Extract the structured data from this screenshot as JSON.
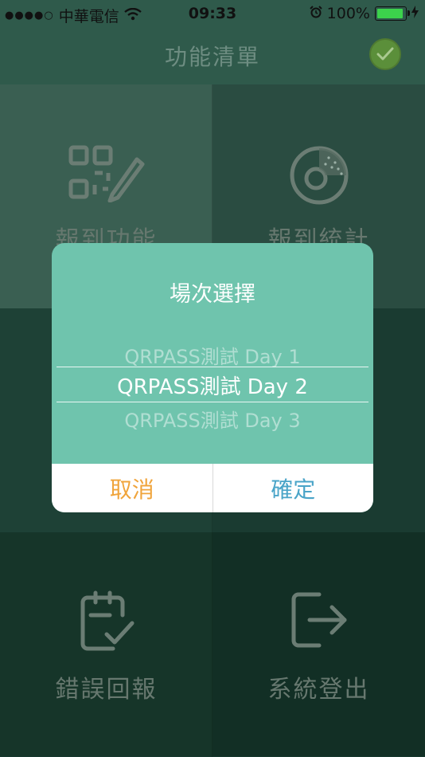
{
  "status_bar": {
    "signal": "●●●●○",
    "carrier": "中華電信",
    "time": "09:33",
    "battery_percent": "100%",
    "battery_level": 1.0
  },
  "nav": {
    "title": "功能清單",
    "check_icon": "checkmark-icon"
  },
  "menu": [
    {
      "label": "報到功能",
      "icon": "qr-code-pen-icon"
    },
    {
      "label": "報到統計",
      "icon": "pie-chart-icon"
    },
    {
      "label": "",
      "icon": ""
    },
    {
      "label": "",
      "icon": ""
    },
    {
      "label": "錯誤回報",
      "icon": "clipboard-check-icon"
    },
    {
      "label": "系統登出",
      "icon": "logout-icon"
    }
  ],
  "dialog": {
    "title": "場次選擇",
    "options": [
      "QRPASS測試 Day 1",
      "QRPASS測試 Day 2",
      "QRPASS測試 Day 3"
    ],
    "selected_index": 1,
    "cancel_label": "取消",
    "confirm_label": "確定"
  },
  "colors": {
    "dialog_bg": "#6fc4ad",
    "cancel": "#f0a43b",
    "confirm": "#4aa4c8",
    "check_badge": "#5b8f3a"
  }
}
